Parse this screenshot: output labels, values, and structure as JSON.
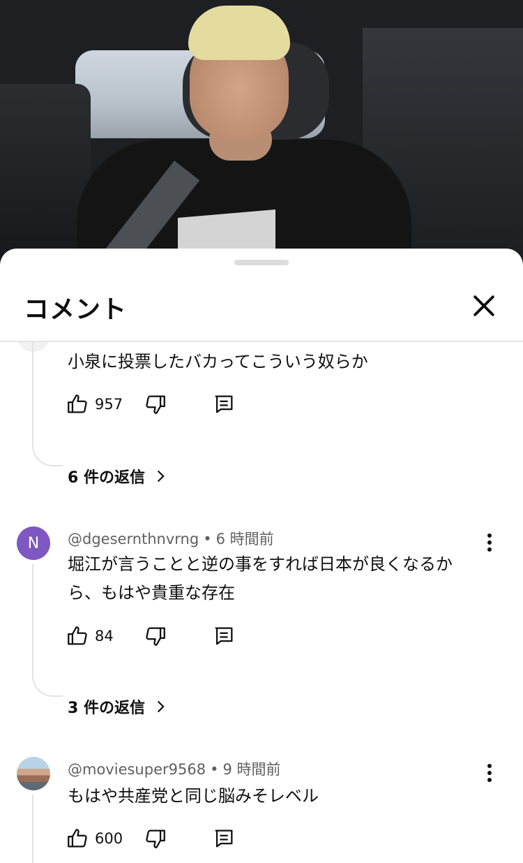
{
  "sheet": {
    "title": "コメント"
  },
  "comments": [
    {
      "author": "",
      "time": "",
      "text": "小泉に投票したバカってこういう奴らか",
      "likes": "957",
      "replies": "6 件の返信",
      "avatar_letter": ""
    },
    {
      "author": "@dgesernthnvrng",
      "time": "6 時間前",
      "text": "堀江が言うことと逆の事をすれば日本が良くなるから、もはや貴重な存在",
      "likes": "84",
      "replies": "3 件の返信",
      "avatar_letter": "N",
      "avatar_color": "#7e57c2"
    },
    {
      "author": "@moviesuper9568",
      "time": "9 時間前",
      "text": "もはや共産党と同じ脳みそレベル",
      "likes": "600",
      "replies": "",
      "avatar_letter": ""
    }
  ],
  "icons": {
    "like": "thumbs-up-icon",
    "dislike": "thumbs-down-icon",
    "reply": "reply-comment-icon",
    "more": "more-vertical-icon",
    "close": "close-icon",
    "chevron": "chevron-right-icon"
  }
}
